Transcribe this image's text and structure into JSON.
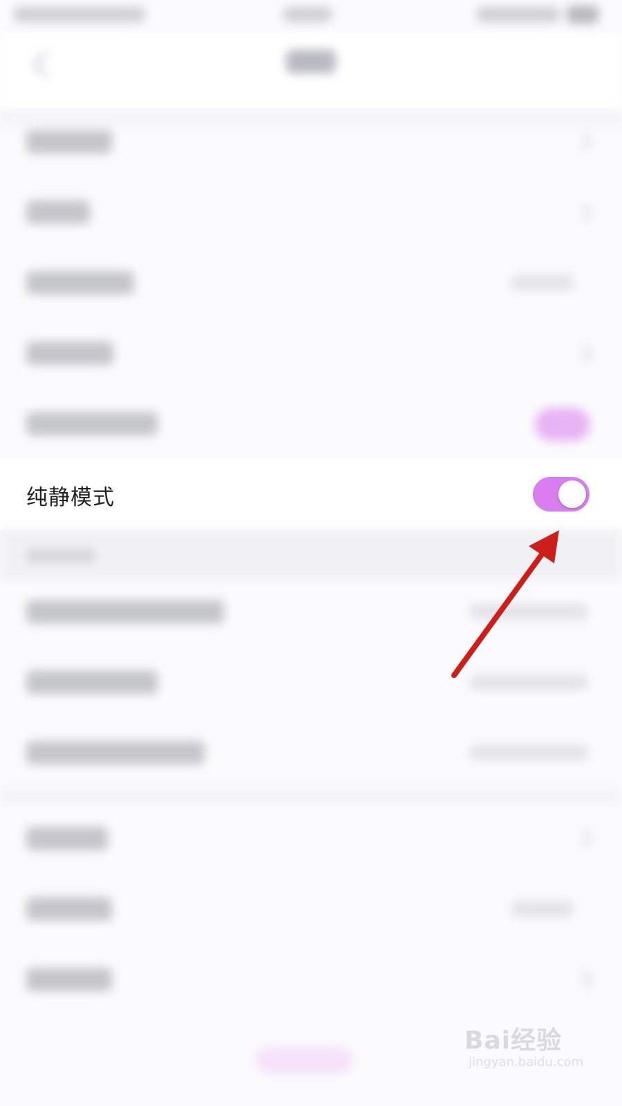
{
  "settings_item": {
    "label": "纯静模式",
    "toggle_on": true
  },
  "colors": {
    "toggle_on": "#d97df0",
    "arrow": "#cc1f1a"
  },
  "watermark": {
    "brand": "Bai经验",
    "url": "jingyan.baidu.com"
  }
}
